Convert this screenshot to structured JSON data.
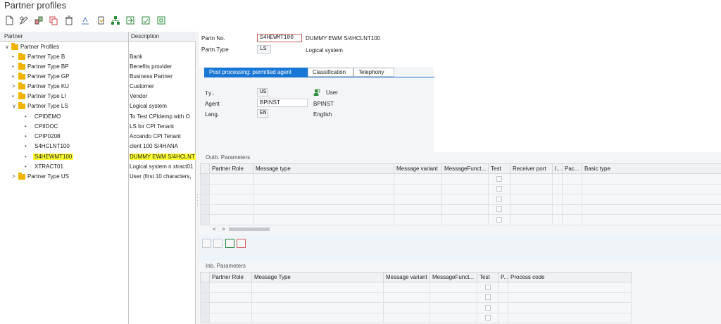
{
  "window": {
    "title": "Partner profiles"
  },
  "toolbar": {
    "icons": [
      "new-icon",
      "display-change-icon",
      "create-icon",
      "copy-icon",
      "delete-icon",
      "transfer-icon",
      "check-icon",
      "partner-structure-icon",
      "import-icon",
      "save-icon",
      "print-icon"
    ]
  },
  "tree": {
    "col_partner": "Partner",
    "col_description": "Description",
    "root": "Partner Profiles",
    "groups": [
      {
        "name": "Partner Type B",
        "desc": "Bank",
        "arrow": "•"
      },
      {
        "name": "Partner Type BP",
        "desc": "Benefits provider",
        "arrow": "•"
      },
      {
        "name": "Partner Type GP",
        "desc": "Business Partner",
        "arrow": "•"
      },
      {
        "name": "Partner Type KU",
        "desc": "Customer",
        "arrow": ">"
      },
      {
        "name": "Partner Type LI",
        "desc": "Vendor",
        "arrow": "•"
      },
      {
        "name": "Partner Type LS",
        "desc": "Logical system",
        "arrow": "∨"
      }
    ],
    "ls_items": [
      {
        "name": "CPIDEMO",
        "desc": "To Test CPIdemp with O"
      },
      {
        "name": "CPIIDOC",
        "desc": "LS for CPI Tenant"
      },
      {
        "name": "CPIP0208",
        "desc": "Accando CPI Tenant"
      },
      {
        "name": "S4HCLNT100",
        "desc": "clent 100 S/4HANA"
      },
      {
        "name": "S4HEWMT100",
        "desc": "DUMMY EWM S/4HCLNT"
      },
      {
        "name": "XTRACT01",
        "desc": "Logical system n xtract01"
      }
    ],
    "last_group": {
      "name": "Partner Type US",
      "desc": "User (first 10 characters,"
    }
  },
  "header": {
    "partner_no_label": "Partn No.",
    "partner_no_value": "S4HEWMT100",
    "partner_no_desc": "DUMMY EWM S/4HCLNT100",
    "partner_type_label": "Partn.Type",
    "partner_type_value": "LS",
    "partner_type_desc": "Logical system"
  },
  "tabs": [
    "Post processing: permitted agent",
    "Classification",
    "Telephony"
  ],
  "agent": {
    "ty_label": "Ty.",
    "ty_value": "US",
    "ty_desc": "User",
    "agent_label": "Agent",
    "agent_value": "BPINST",
    "agent_desc": "BPINST",
    "lang_label": "Lang.",
    "lang_value": "EN",
    "lang_desc": "English"
  },
  "outbound": {
    "title": "Outb. Parameters",
    "columns": [
      "Partner Role",
      "Message type",
      "Message variant",
      "MessageFunct...",
      "Test",
      "Receiver port",
      "I...",
      "Pac...",
      "Basic type"
    ]
  },
  "scroll": {
    "left": "<",
    "right": ">"
  },
  "inbound": {
    "title": "Inb. Parameters",
    "columns": [
      "Partner Role",
      "Message Type",
      "Message variant",
      "MessageFunct...",
      "Test",
      "P...",
      "Process code"
    ]
  },
  "colors": {
    "accent": "#1877d4",
    "highlight": "#ffff33",
    "folder": "#f0b400"
  }
}
